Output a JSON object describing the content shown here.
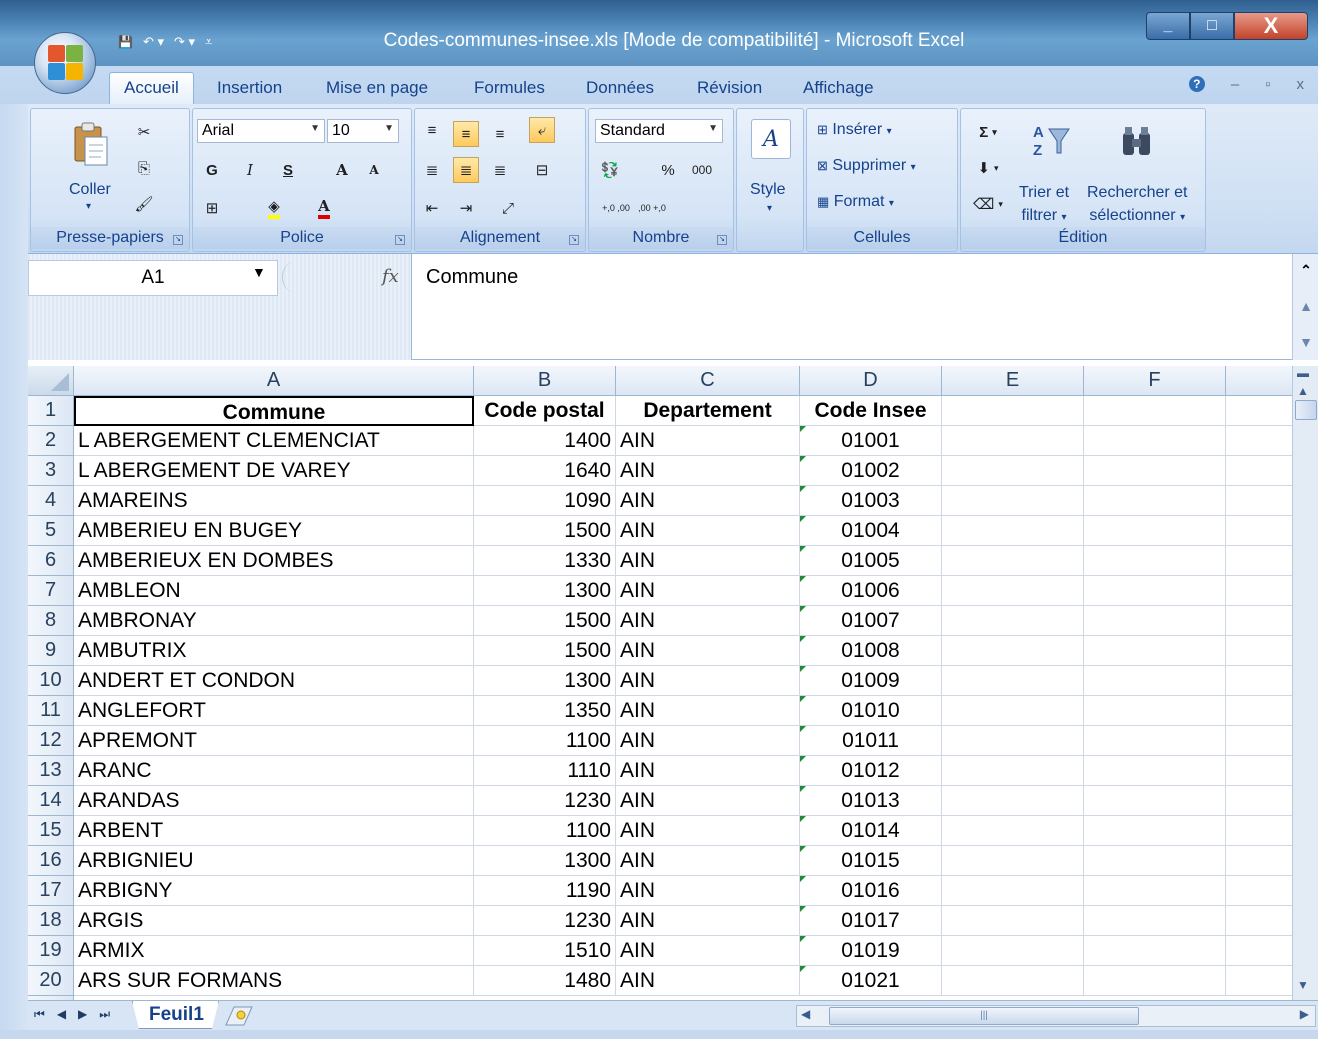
{
  "window": {
    "title": "Codes-communes-insee.xls  [Mode de compatibilité] - Microsoft Excel",
    "minimize": "_",
    "maximize": "□",
    "close": "X"
  },
  "qat": {
    "save": "💾",
    "undo": "↶ ▾",
    "redo": "↷ ▾",
    "customize": "⩡"
  },
  "tabs": [
    "Accueil",
    "Insertion",
    "Mise en page",
    "Formules",
    "Données",
    "Révision",
    "Affichage"
  ],
  "tab_right": {
    "help": "?",
    "min": "–",
    "restore": "▫",
    "close": "x"
  },
  "ribbon": {
    "clipboard": {
      "label": "Presse-papiers",
      "paste": "Coller"
    },
    "font": {
      "label": "Police",
      "name": "Arial",
      "size": "10",
      "bold": "G",
      "italic": "I",
      "underline": "S",
      "grow": "A",
      "shrink": "A"
    },
    "alignment": {
      "label": "Alignement"
    },
    "number": {
      "label": "Nombre",
      "format": "Standard",
      "percent": "%",
      "thousands": "000",
      "inc_dec": "+,0 ,00",
      "dec_dec": ",00 +,0"
    },
    "styles": {
      "label": "Style"
    },
    "cells": {
      "label": "Cellules",
      "insert": "Insérer",
      "delete": "Supprimer",
      "format": "Format"
    },
    "editing": {
      "label": "Édition",
      "sum": "Σ",
      "sort_line1": "Trier et",
      "sort_line2": "filtrer",
      "find_line1": "Rechercher et",
      "find_line2": "sélectionner"
    }
  },
  "formula_bar": {
    "name_box": "A1",
    "fx": "fx",
    "content": "Commune"
  },
  "columns": [
    "A",
    "B",
    "C",
    "D",
    "E",
    "F"
  ],
  "header_row": [
    "Commune",
    "Code postal",
    "Departement",
    "Code Insee"
  ],
  "rows": [
    {
      "n": "1"
    },
    {
      "n": "2",
      "commune": "L ABERGEMENT CLEMENCIAT",
      "cp": "1400",
      "dep": "AIN",
      "insee": "01001"
    },
    {
      "n": "3",
      "commune": "L ABERGEMENT DE VAREY",
      "cp": "1640",
      "dep": "AIN",
      "insee": "01002"
    },
    {
      "n": "4",
      "commune": "AMAREINS",
      "cp": "1090",
      "dep": "AIN",
      "insee": "01003"
    },
    {
      "n": "5",
      "commune": "AMBERIEU EN BUGEY",
      "cp": "1500",
      "dep": "AIN",
      "insee": "01004"
    },
    {
      "n": "6",
      "commune": "AMBERIEUX EN DOMBES",
      "cp": "1330",
      "dep": "AIN",
      "insee": "01005"
    },
    {
      "n": "7",
      "commune": "AMBLEON",
      "cp": "1300",
      "dep": "AIN",
      "insee": "01006"
    },
    {
      "n": "8",
      "commune": "AMBRONAY",
      "cp": "1500",
      "dep": "AIN",
      "insee": "01007"
    },
    {
      "n": "9",
      "commune": "AMBUTRIX",
      "cp": "1500",
      "dep": "AIN",
      "insee": "01008"
    },
    {
      "n": "10",
      "commune": "ANDERT ET CONDON",
      "cp": "1300",
      "dep": "AIN",
      "insee": "01009"
    },
    {
      "n": "11",
      "commune": "ANGLEFORT",
      "cp": "1350",
      "dep": "AIN",
      "insee": "01010"
    },
    {
      "n": "12",
      "commune": "APREMONT",
      "cp": "1100",
      "dep": "AIN",
      "insee": "01011"
    },
    {
      "n": "13",
      "commune": "ARANC",
      "cp": "1110",
      "dep": "AIN",
      "insee": "01012"
    },
    {
      "n": "14",
      "commune": "ARANDAS",
      "cp": "1230",
      "dep": "AIN",
      "insee": "01013"
    },
    {
      "n": "15",
      "commune": "ARBENT",
      "cp": "1100",
      "dep": "AIN",
      "insee": "01014"
    },
    {
      "n": "16",
      "commune": "ARBIGNIEU",
      "cp": "1300",
      "dep": "AIN",
      "insee": "01015"
    },
    {
      "n": "17",
      "commune": "ARBIGNY",
      "cp": "1190",
      "dep": "AIN",
      "insee": "01016"
    },
    {
      "n": "18",
      "commune": "ARGIS",
      "cp": "1230",
      "dep": "AIN",
      "insee": "01017"
    },
    {
      "n": "19",
      "commune": "ARMIX",
      "cp": "1510",
      "dep": "AIN",
      "insee": "01019"
    },
    {
      "n": "20",
      "commune": "ARS SUR FORMANS",
      "cp": "1480",
      "dep": "AIN",
      "insee": "01021"
    }
  ],
  "sheets": {
    "active": "Feuil1",
    "nav": [
      "⏮",
      "◀",
      "▶",
      "⏭"
    ],
    "hscroll_grip": "|||"
  },
  "colors": {
    "accent": "#15428b",
    "ribbon": "#cfe0f4",
    "highlight": "#ffc95c",
    "triangle": "#1e8a3a"
  }
}
